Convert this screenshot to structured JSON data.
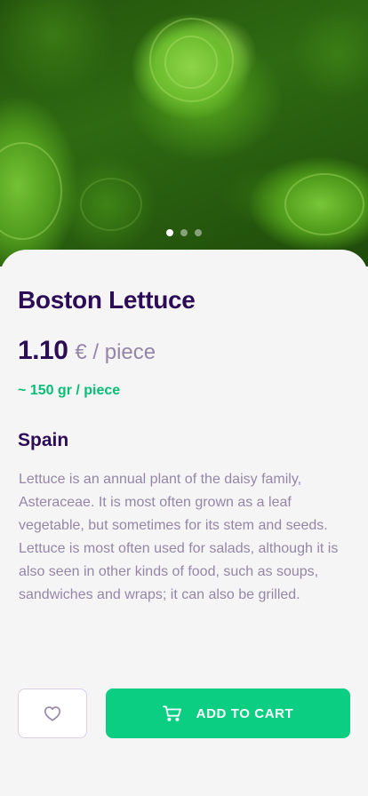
{
  "product": {
    "name": "Boston Lettuce",
    "price": "1.10",
    "unit": "€ / piece",
    "weight": "~ 150 gr / piece",
    "origin": "Spain",
    "description": "Lettuce is an annual plant of the daisy family, Asteraceae. It is most often grown as a leaf vegetable, but sometimes for its stem and seeds. Lettuce is most often used for salads, although it is also seen in other kinds of food, such as soups, sandwiches and wraps; it can also be grilled."
  },
  "gallery": {
    "image_icon": "lettuce-photo",
    "slides": 3,
    "active_slide": 1
  },
  "actions": {
    "favorite_icon": "heart-icon",
    "add_to_cart_label": "ADD TO CART",
    "cart_icon": "cart-icon"
  },
  "colors": {
    "primary_dark": "#2d0c57",
    "accent_green": "#0bce83",
    "weight_green": "#06be77",
    "muted_text": "#9586a8",
    "background": "#f6f5f5"
  }
}
